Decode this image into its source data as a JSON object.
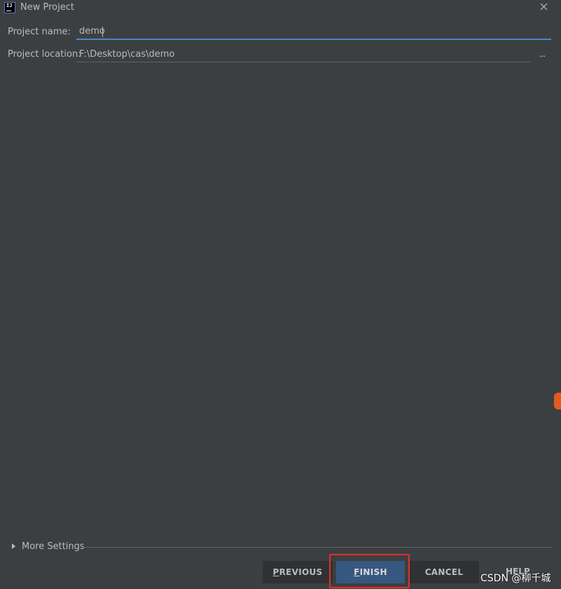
{
  "window": {
    "app_icon_text": "IJ",
    "title": "New Project"
  },
  "form": {
    "project_name_label": "Project name:",
    "project_name_value": "demo",
    "project_location_label": "Project location:",
    "project_location_value": "F:\\Desktop\\cas\\demo",
    "browse_label": "..."
  },
  "more_settings": {
    "label": "More Settings"
  },
  "buttons": {
    "previous": {
      "mnemonic": "P",
      "rest": "REVIOUS"
    },
    "finish": {
      "mnemonic": "F",
      "rest": "INISH"
    },
    "cancel": "CANCEL",
    "help": "HELP"
  },
  "watermark": "CSDN @柳千城",
  "colors": {
    "background": "#3c3f41",
    "accent": "#4a88c7",
    "finish_button": "#365880",
    "highlight": "#e03030"
  }
}
